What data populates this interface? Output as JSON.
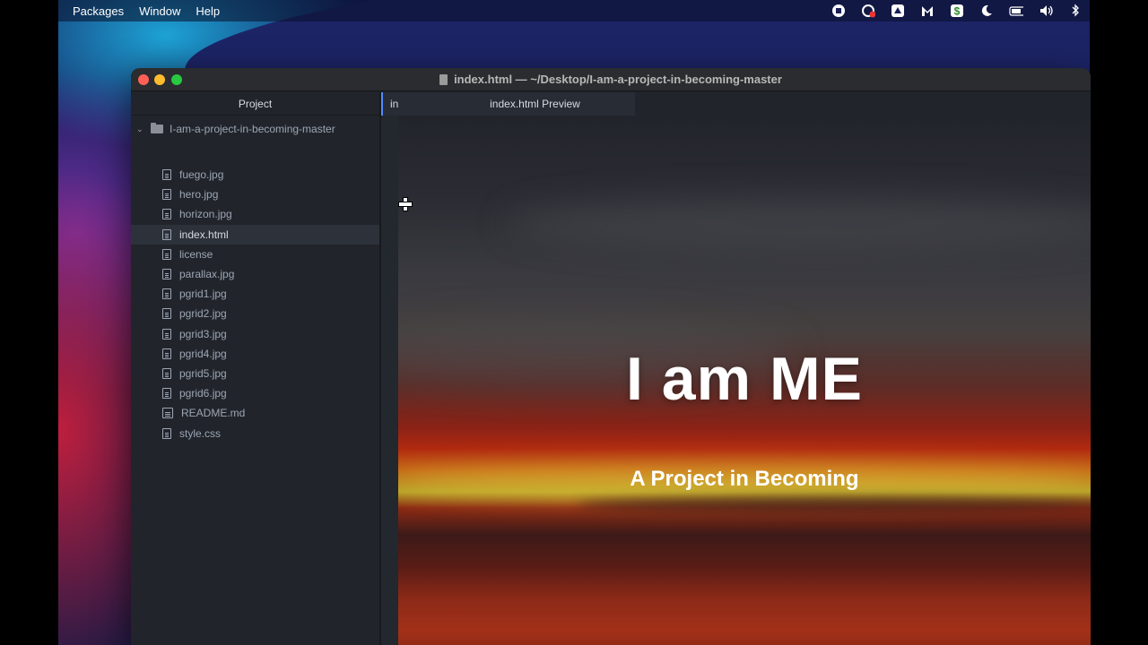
{
  "menubar": {
    "items": [
      "Packages",
      "Window",
      "Help"
    ],
    "tray_icons": [
      "record-icon",
      "creative-cloud-icon",
      "drive-icon",
      "malwarebytes-icon",
      "dollar-icon",
      "moon-icon",
      "battery-icon",
      "volume-icon",
      "bluetooth-icon"
    ]
  },
  "window": {
    "title": "index.html — ~/Desktop/I-am-a-project-in-becoming-master"
  },
  "sidebar": {
    "header": "Project",
    "root_folder": "I-am-a-project-in-becoming-master",
    "files": [
      {
        "name": "fuego.jpg"
      },
      {
        "name": "hero.jpg"
      },
      {
        "name": "horizon.jpg"
      },
      {
        "name": "index.html",
        "selected": true
      },
      {
        "name": "license"
      },
      {
        "name": "parallax.jpg"
      },
      {
        "name": "pgrid1.jpg"
      },
      {
        "name": "pgrid2.jpg"
      },
      {
        "name": "pgrid3.jpg"
      },
      {
        "name": "pgrid4.jpg"
      },
      {
        "name": "pgrid5.jpg"
      },
      {
        "name": "pgrid6.jpg"
      },
      {
        "name": "README.md"
      },
      {
        "name": "style.css"
      }
    ]
  },
  "tabs": {
    "editor_label": "in",
    "preview_label": "index.html Preview"
  },
  "preview": {
    "title": "I am ME",
    "subtitle": "A Project in Becoming"
  },
  "colors": {
    "accent": "#528bff",
    "sidebar_bg": "#21252b",
    "selected_row": "#2c313a"
  }
}
